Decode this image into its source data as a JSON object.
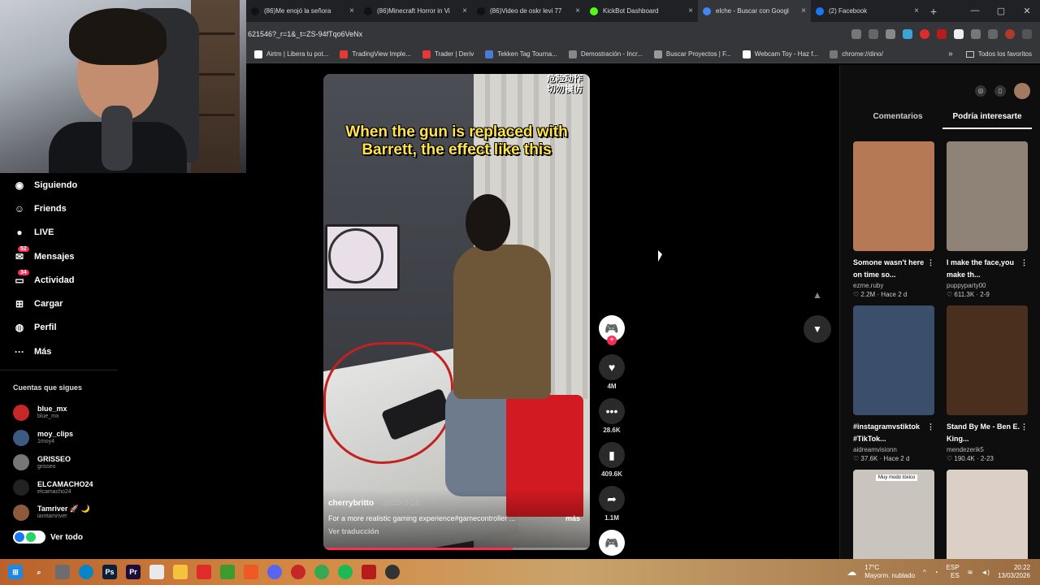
{
  "browser": {
    "tabs": [
      {
        "title": "(86)Me enojó la señora",
        "color": "#111",
        "active": false
      },
      {
        "title": "(86)Minecraft Horror in Vi",
        "color": "#111",
        "active": false
      },
      {
        "title": "(86)Video de oskr levi 77",
        "color": "#111",
        "active": false
      },
      {
        "title": "KickBot Dashboard",
        "color": "#53fc18",
        "active": false
      },
      {
        "title": "elche - Buscar con Googl",
        "color": "#4285f4",
        "active": true
      },
      {
        "title": "(2) Facebook",
        "color": "#1877f2",
        "active": false
      }
    ],
    "new_tab": "+",
    "url": "621546?_r=1&_t=ZS-94fTqo6VeNx",
    "bookmarks": [
      {
        "label": "Airtm | Libera tu pot...",
        "color": "#fff"
      },
      {
        "label": "TradingView Imple...",
        "color": "#e53935"
      },
      {
        "label": "Trader | Deriv",
        "color": "#e53935"
      },
      {
        "label": "Tekken Tag Tourna...",
        "color": "#4a7bd0"
      },
      {
        "label": "Demostración - Incr...",
        "color": "#888"
      },
      {
        "label": "Buscar Proyectos | F...",
        "color": "#999"
      },
      {
        "label": "Webcam Toy - Haz f...",
        "color": "#fff"
      },
      {
        "label": "chrome://dino/",
        "color": "#777"
      }
    ],
    "bookmarks_more": "»",
    "all_bookmarks": "Todos los favoritos"
  },
  "sidebar": {
    "items": [
      {
        "label": "Siguiendo",
        "icon": "following-icon",
        "glyph": "◉",
        "badge": ""
      },
      {
        "label": "Friends",
        "icon": "friends-icon",
        "glyph": "☺",
        "badge": ""
      },
      {
        "label": "LIVE",
        "icon": "live-icon",
        "glyph": "●",
        "badge": ""
      },
      {
        "label": "Mensajes",
        "icon": "messages-icon",
        "glyph": "✉",
        "badge": "52"
      },
      {
        "label": "Actividad",
        "icon": "activity-icon",
        "glyph": "▭",
        "badge": "34"
      },
      {
        "label": "Cargar",
        "icon": "upload-icon",
        "glyph": "⊞",
        "badge": ""
      },
      {
        "label": "Perfil",
        "icon": "profile-icon",
        "glyph": "◍",
        "badge": ""
      },
      {
        "label": "Más",
        "icon": "more-icon",
        "glyph": "···",
        "badge": ""
      }
    ],
    "following_header": "Cuentas que sigues",
    "accounts": [
      {
        "name": "blue_mx",
        "user": "blue_mx",
        "color": "#c62828"
      },
      {
        "name": "moy_clips",
        "user": "1moy4",
        "color": "#3d5a80"
      },
      {
        "name": "GRISSEO",
        "user": "grisseo",
        "color": "#777"
      },
      {
        "name": "ELCAMACHO24",
        "user": "elcamacho24",
        "color": "#222"
      },
      {
        "name": "Tamriver 🚀 🌙",
        "user": "iamtamriver",
        "color": "#8e5a3c"
      }
    ],
    "see_all": "Ver todo"
  },
  "video": {
    "caption": "When the gun is replaced with Barrett, the effect like this",
    "chinese_overlay": "危险动作 切勿模仿",
    "author": "cherrybritto",
    "date": "· 2023-5-16",
    "description": "For a more realistic gaming experience#gamecontroller ...",
    "more": "más",
    "translate": "Ver traducción",
    "progress": 0.71
  },
  "actions": {
    "likes": "4M",
    "comments": "28.6K",
    "saves": "409.6K",
    "shares": "1.1M"
  },
  "right_panel": {
    "tabs": [
      "Comentarios",
      "Podría interesarte"
    ],
    "active_tab": 1,
    "cards": [
      {
        "title": "Somone wasn't here on time so...",
        "user": "ezme.ruby",
        "stats": "♡ 2.2M · Hace 2 d",
        "color": "#b57a55"
      },
      {
        "title": "I make the face,you make th...",
        "user": "puppyparty00",
        "stats": "♡ 611.3K · 2-9",
        "color": "#8f8378"
      },
      {
        "title": "#instagramvstiktok #TikTok...",
        "user": "aidreamvisionn",
        "stats": "♡ 37.6K · Hace 2 d",
        "color": "#3b4e6c"
      },
      {
        "title": "Stand By Me - Ben E. King...",
        "user": "mendezerik5",
        "stats": "♡ 190.4K · 2-23",
        "color": "#4a2e1e"
      },
      {
        "title": "",
        "user": "",
        "stats": "",
        "color": "#c9c4bd"
      },
      {
        "title": "",
        "user": "",
        "stats": "",
        "color": "#dcd0c6"
      }
    ],
    "card5_label": "Muy modo tóxico"
  },
  "taskbar": {
    "weather_temp": "17°C",
    "weather_desc": "Mayorm. nublado",
    "lang": "ESP",
    "lang2": "ES",
    "time": "20:22",
    "date": "13/03/2026"
  }
}
